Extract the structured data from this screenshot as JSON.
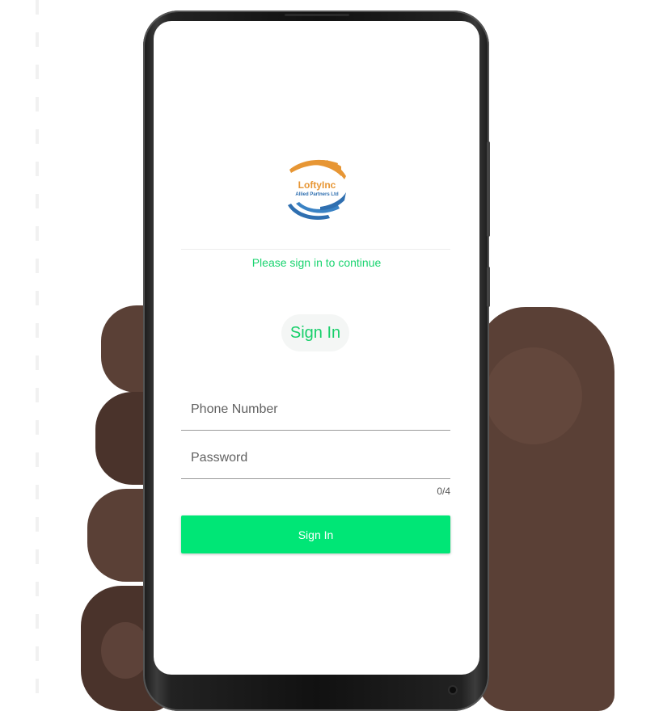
{
  "logo": {
    "title": "LoftyInc",
    "subtitle": "Allied Partners Ltd"
  },
  "login": {
    "subtitle": "Please sign in to continue",
    "heading": "Sign In",
    "phone_placeholder": "Phone Number",
    "password_placeholder": "Password",
    "password_counter": "0/4",
    "submit_label": "Sign In"
  },
  "colors": {
    "accent": "#00e676",
    "accent_text": "#19d46f",
    "logo_orange": "#e79634",
    "logo_blue": "#2f6fb0"
  }
}
